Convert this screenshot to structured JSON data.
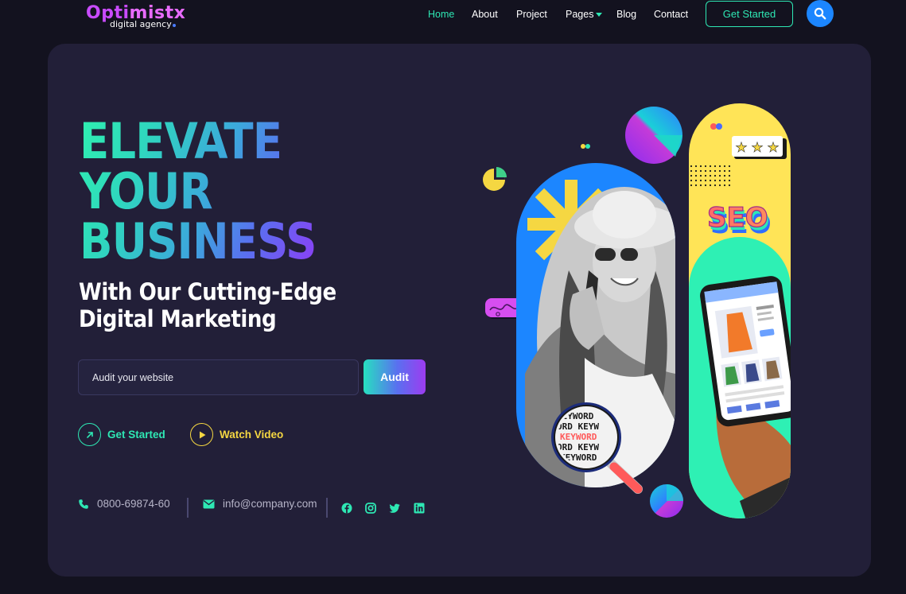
{
  "brand": {
    "name_part1": "Opti",
    "name_part2": "mistx",
    "tagline": "digital agency"
  },
  "nav": {
    "items": [
      {
        "label": "Home",
        "active": true
      },
      {
        "label": "About",
        "active": false
      },
      {
        "label": "Project",
        "active": false
      },
      {
        "label": "Pages",
        "active": false,
        "dropdown": true
      },
      {
        "label": "Blog",
        "active": false
      },
      {
        "label": "Contact",
        "active": false
      }
    ],
    "cta_label": "Get Started",
    "search_icon": "search-icon"
  },
  "hero": {
    "headline_lines": [
      "ELEVATE",
      "YOUR",
      "BUSINESS"
    ],
    "subhead_lines": [
      "With Our Cutting-Edge",
      "Digital Marketing"
    ],
    "audit": {
      "placeholder": "Audit your website",
      "button_label": "Audit"
    },
    "actions": {
      "get_started_label": "Get Started",
      "get_started_icon": "arrow-up-right-icon",
      "watch_video_label": "Watch Video",
      "watch_video_icon": "play-icon"
    },
    "contact": {
      "phone": "0800-69874-60",
      "email": "info@company.com"
    },
    "social_icons": [
      "facebook-icon",
      "instagram-icon",
      "twitter-icon",
      "linkedin-icon"
    ]
  },
  "illustration": {
    "seo_label": "SEO",
    "keyword_lines": [
      "KEYWORD",
      "ORD KEYW",
      "KEYWORD",
      "ORD KEYW",
      "KEYWORD"
    ]
  },
  "colors": {
    "accent_green": "#2ee8b4",
    "accent_blue": "#1c86ff",
    "accent_yellow": "#f5d742",
    "accent_purple": "#9d3cf0",
    "background": "#13121f",
    "card": "#221f38"
  }
}
